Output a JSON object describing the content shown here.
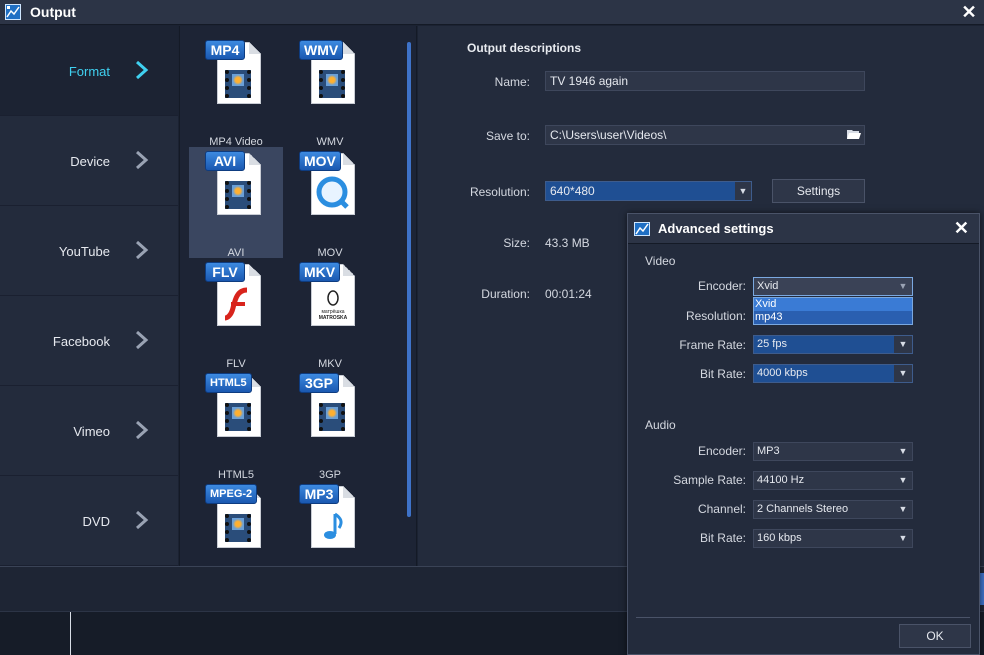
{
  "window": {
    "title": "Output",
    "close_icon": "close-icon"
  },
  "nav": {
    "items": [
      {
        "label": "Format",
        "active": true
      },
      {
        "label": "Device",
        "active": false
      },
      {
        "label": "YouTube",
        "active": false
      },
      {
        "label": "Facebook",
        "active": false
      },
      {
        "label": "Vimeo",
        "active": false
      },
      {
        "label": "DVD",
        "active": false
      }
    ],
    "active_color": "#3fd0f0"
  },
  "formats": [
    {
      "badge": "MP4",
      "name": "MP4 Video",
      "selected": false
    },
    {
      "badge": "WMV",
      "name": "WMV",
      "selected": false
    },
    {
      "badge": "AVI",
      "name": "AVI",
      "selected": true
    },
    {
      "badge": "MOV",
      "name": "MOV",
      "selected": false
    },
    {
      "badge": "FLV",
      "name": "FLV",
      "selected": false
    },
    {
      "badge": "MKV",
      "name": "MKV",
      "selected": false
    },
    {
      "badge": "HTML5",
      "name": "HTML5",
      "selected": false
    },
    {
      "badge": "3GP",
      "name": "3GP",
      "selected": false
    },
    {
      "badge": "MPEG-2",
      "name": "",
      "selected": false
    },
    {
      "badge": "MP3",
      "name": "",
      "selected": false
    }
  ],
  "mkv_doc_text": [
    "матрёшка",
    "MATROSKA"
  ],
  "output": {
    "heading": "Output descriptions",
    "name_label": "Name:",
    "name_value": "TV 1946 again",
    "save_label": "Save to:",
    "save_value": "C:\\Users\\user\\Videos\\",
    "resolution_label": "Resolution:",
    "resolution_value": "640*480",
    "settings_button": "Settings",
    "size_label": "Size:",
    "size_value": "43.3 MB",
    "duration_label": "Duration:",
    "duration_value": "00:01:24"
  },
  "dialog": {
    "title": "Advanced settings",
    "video_section": "Video",
    "video": {
      "encoder_label": "Encoder:",
      "encoder_value": "Xvid",
      "encoder_options": [
        "Xvid",
        "mp43"
      ],
      "resolution_label": "Resolution:",
      "framerate_label": "Frame Rate:",
      "framerate_value": "25 fps",
      "bitrate_label": "Bit Rate:",
      "bitrate_value": "4000 kbps"
    },
    "audio_section": "Audio",
    "audio": {
      "encoder_label": "Encoder:",
      "encoder_value": "MP3",
      "samplerate_label": "Sample Rate:",
      "samplerate_value": "44100 Hz",
      "channel_label": "Channel:",
      "channel_value": "2 Channels Stereo",
      "bitrate_label": "Bit Rate:",
      "bitrate_value": "160 kbps"
    },
    "ok_button": "OK"
  }
}
